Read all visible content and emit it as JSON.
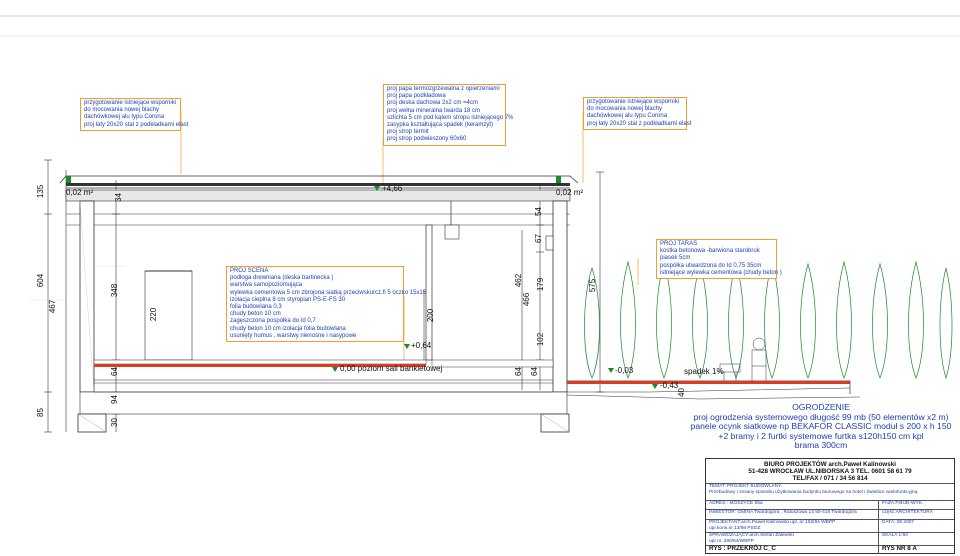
{
  "notes": {
    "left_roof": [
      "przygotowanie istniejące wsporniki",
      "do mocowania nowej blachy",
      "dachówkowej alu typu Corona",
      "proj łaty 20x20 stal z podkładkami elast"
    ],
    "roof_layers": [
      "proj papa termozgrzewalna z opierzeniami",
      "proj papa podkładowa",
      "proj deska dachowa 2x2 cm =4cm",
      "proj wełna mineralna twarda 18 cm",
      "szlichta 5 cm pod kątem stropu istniejącego 7%",
      "zasypka kształtująca spadek (keramzyt)",
      "proj strop termit",
      "proj strop podwieszony 60x60"
    ],
    "right_roof": [
      "przygotowanie istniejące wsporniki",
      "do mocowania nowej blachy",
      "dachówkowej alu typu Corona",
      "proj łaty 20x20 stal z podkładkami elast"
    ],
    "stage": [
      "PROJ SCENA",
      "podłoga drewniana (deska bartinecka )",
      "warstwa samopoziomująca",
      "wylewka cementowa 5 cm zbrojona siatką przeciwskurcz.fi 5 oczko 15x15",
      "izolacja cieplna 8 cm styropian PS-E-FS 30",
      "folia budowlana 0,3",
      "chudy beton 10 cm",
      "zagęszczona pospółka do Id 0,7",
      "chudy beton 10 cm izolacja folia budowlana",
      "usunięty humus , warstwy nienośne i nasypowe"
    ],
    "terrace": [
      "PROJ TARAS",
      "kostka betonowa -barwiona starobruk",
      "piasek 5cm",
      "pospółka utwardzona do Id 0,75 35cm",
      "istniejące wylewka cementowa (chudy beton )"
    ]
  },
  "dimensions": {
    "d135": "135",
    "d604": "604",
    "d467": "467",
    "d348": "348",
    "d220": "220",
    "d64a": "64",
    "d94": "94",
    "d30": "30",
    "d85": "85",
    "d34": "34",
    "d54": "54",
    "d67": "67",
    "d466": "466",
    "d462": "462",
    "d179": "179",
    "d102": "102",
    "d64b": "64",
    "d64c": "64",
    "d575": "575",
    "d200": "200",
    "d40": "40"
  },
  "levels": {
    "slope_left": "0,02 m²",
    "slope_right": "0,02 m²",
    "top": "+4,66",
    "stage": "+0,64",
    "zero": "0,00 poziom sali bankietowej",
    "terrace": "-0,03",
    "ground": "-0,43",
    "slope_note": "spadek 1%"
  },
  "fence": [
    "OGRODZENIE",
    "proj  ogrodzenia systemowego  długość 99 mb (50 elementów x2 m)",
    "panele ocynk siatkowe np BEKAFOR CLASSIC moduł s 200 x h 150",
    "+2 bramy i 2 furtki systemowe furtka s120h150 cm kpl",
    "brama 300cm"
  ],
  "title_block": {
    "office": [
      "BIURO PROJEKTÓW arch.Paweł Kalinowski",
      "51-428 WROCŁAW UL.NIBORSKA 3 TEL. 0601 58 61 79",
      "TEL/FAX  / 071 / 34 56 814"
    ],
    "topic_label": "TEMAT: PROJEKT BUDOWLANY",
    "topic": "Przebudowy i zmiany sposobu użytkowania budynku biurowego na hotel i świetlice wielofunkcyjną",
    "address": "ADRES :  MOSZYCE 55a",
    "phase": "FAZA:P.BUD-WYK.",
    "investor": "INWESTOR: GMINA Twardogóra , Ratuszowa 14     50-416 Twardogóra",
    "part": "część:ARCHITEKTURA",
    "designer": [
      "PROJEKTANT:arch.Paweł Kalinowski upr. nr 162/84 WBPP",
      "upr.kons.nr  13/98 PSOZ"
    ],
    "date": "DATA: 09 2007",
    "checker": [
      "SPRAWDZAJĄCY:arch.Stefan Zalewski",
      "upr.nr. 290/84/WBPP"
    ],
    "scale": "SKALA 1:50",
    "drawing": "RYS : PRZEKRÓJ C_C",
    "number": "RYS NR 8 A"
  }
}
